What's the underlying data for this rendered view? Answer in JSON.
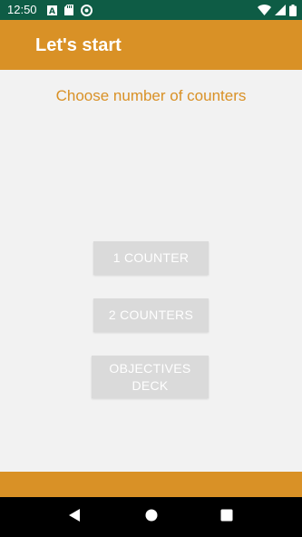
{
  "status_bar": {
    "time": "12:50",
    "left_icons": [
      "text-a-icon",
      "sd-card-icon",
      "sync-circle-icon"
    ],
    "right_icons": [
      "wifi-icon",
      "signal-icon",
      "battery-icon"
    ]
  },
  "app_bar": {
    "title": "Let's start"
  },
  "main": {
    "subtitle": "Choose number of counters",
    "buttons": [
      {
        "label": "1 COUNTER"
      },
      {
        "label": "2 COUNTERS"
      },
      {
        "label": "OBJECTIVES DECK"
      }
    ]
  },
  "nav_bar": {
    "icons": [
      "back-icon",
      "home-icon",
      "recents-icon"
    ]
  },
  "colors": {
    "status_bar": "#0e5c45",
    "accent": "#d99126",
    "background": "#f2f2f2",
    "button": "#dadada",
    "button_text": "#ffffff",
    "nav_bar": "#000000"
  }
}
